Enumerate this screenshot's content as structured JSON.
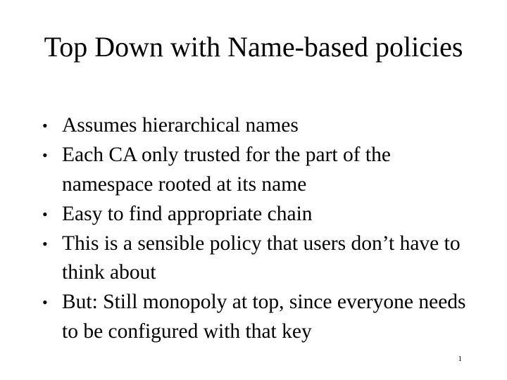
{
  "slide": {
    "title": "Top Down with Name-based policies",
    "title_line_1": "Top Down with Name-based",
    "title_line_2": "policies",
    "bullet_marker": "•",
    "bullets": [
      {
        "text": "Assumes hierarchical names"
      },
      {
        "text": "Each CA only trusted for the part of the namespace rooted at its name"
      },
      {
        "text": "Easy to find appropriate chain"
      },
      {
        "text": "This is a sensible policy that users don’t have to think about"
      },
      {
        "text": "But: Still monopoly at top, since everyone needs to be configured with that key"
      }
    ],
    "page_number": "1",
    "colors": {
      "background": "#ffffff",
      "text": "#000000"
    }
  }
}
